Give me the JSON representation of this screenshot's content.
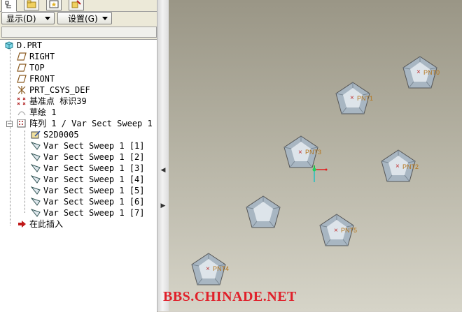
{
  "toolbar": {
    "display_label": "显示(D)",
    "settings_label": "设置(G)"
  },
  "tabs": [
    {
      "icon": "model-tree-icon"
    },
    {
      "icon": "folder-browser-icon"
    },
    {
      "icon": "favorites-icon"
    },
    {
      "icon": "connections-icon"
    }
  ],
  "tree": {
    "root": "D.PRT",
    "items": [
      {
        "label": "RIGHT",
        "icon": "datum-plane-icon"
      },
      {
        "label": "TOP",
        "icon": "datum-plane-icon"
      },
      {
        "label": "FRONT",
        "icon": "datum-plane-icon"
      },
      {
        "label": "PRT_CSYS_DEF",
        "icon": "coordinate-system-icon"
      },
      {
        "label": "基准点 标识39",
        "icon": "datum-point-icon"
      },
      {
        "label": "草绘 1",
        "icon": "sketch-icon"
      },
      {
        "label": "阵列 1 / Var Sect Sweep 1",
        "icon": "pattern-icon"
      }
    ],
    "children": [
      {
        "label": "S2D0005",
        "icon": "sketch-edit-icon"
      },
      {
        "label": "Var Sect Sweep 1 [1]",
        "icon": "sweep-feature-icon"
      },
      {
        "label": "Var Sect Sweep 1 [2]",
        "icon": "sweep-feature-icon"
      },
      {
        "label": "Var Sect Sweep 1 [3]",
        "icon": "sweep-feature-icon"
      },
      {
        "label": "Var Sect Sweep 1 [4]",
        "icon": "sweep-feature-icon"
      },
      {
        "label": "Var Sect Sweep 1 [5]",
        "icon": "sweep-feature-icon"
      },
      {
        "label": "Var Sect Sweep 1 [6]",
        "icon": "sweep-feature-icon"
      },
      {
        "label": "Var Sect Sweep 1 [7]",
        "icon": "sweep-feature-icon"
      }
    ],
    "insert_here": "在此插入"
  },
  "viewport": {
    "points": [
      {
        "label": "PNT0"
      },
      {
        "label": "PNT1"
      },
      {
        "label": "PNT2"
      },
      {
        "label": "PNT3"
      },
      {
        "label": "PNT4"
      },
      {
        "label": "PNT5"
      }
    ],
    "colors": {
      "point_label": "#b4741a",
      "point_marker": "#c03030",
      "csys_x": "#e02020",
      "csys_y": "#20c040",
      "csys_z": "#20c0c0"
    }
  },
  "watermark": "BBS.CHINADE.NET"
}
